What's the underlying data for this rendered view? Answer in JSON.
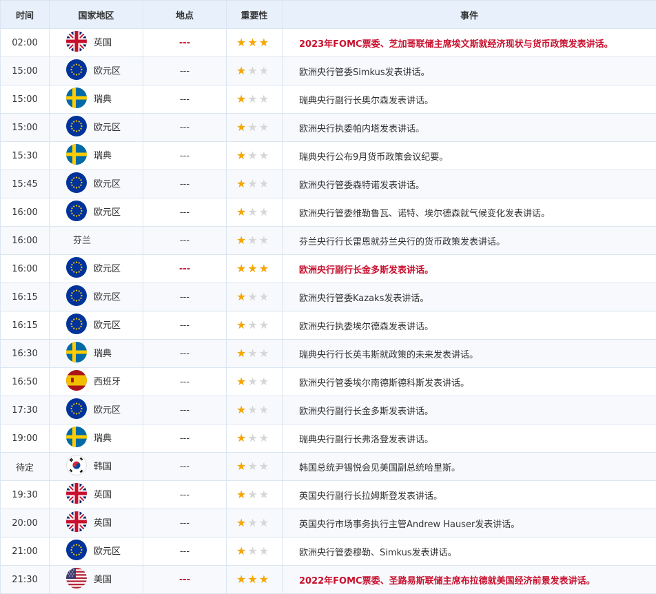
{
  "columns": {
    "time": "时间",
    "country": "国家地区",
    "location": "地点",
    "importance": "重要性",
    "event": "事件"
  },
  "colors": {
    "highlight": "#c8102e",
    "star_on": "#f5a500",
    "star_off": "#d6d6d6",
    "header_bg": "#e7f0fb"
  },
  "rows": [
    {
      "time": "02:00",
      "flag": "uk",
      "country": "英国",
      "location": "---",
      "stars": 3,
      "event": "2023年FOMC票委、芝加哥联储主席埃文斯就经济现状与货币政策发表讲话。",
      "highlight": true
    },
    {
      "time": "15:00",
      "flag": "eu",
      "country": "欧元区",
      "location": "---",
      "stars": 1,
      "event": "欧洲央行管委Simkus发表讲话。",
      "highlight": false
    },
    {
      "time": "15:00",
      "flag": "se",
      "country": "瑞典",
      "location": "---",
      "stars": 1,
      "event": "瑞典央行副行长奥尔森发表讲话。",
      "highlight": false
    },
    {
      "time": "15:00",
      "flag": "eu",
      "country": "欧元区",
      "location": "---",
      "stars": 1,
      "event": "欧洲央行执委帕内塔发表讲话。",
      "highlight": false
    },
    {
      "time": "15:30",
      "flag": "se",
      "country": "瑞典",
      "location": "---",
      "stars": 1,
      "event": "瑞典央行公布9月货币政策会议纪要。",
      "highlight": false
    },
    {
      "time": "15:45",
      "flag": "eu",
      "country": "欧元区",
      "location": "---",
      "stars": 1,
      "event": "欧洲央行管委森特诺发表讲话。",
      "highlight": false
    },
    {
      "time": "16:00",
      "flag": "eu",
      "country": "欧元区",
      "location": "---",
      "stars": 1,
      "event": "欧洲央行管委维勒鲁瓦、诺特、埃尔德森就气候变化发表讲话。",
      "highlight": false
    },
    {
      "time": "16:00",
      "flag": "none",
      "country": "芬兰",
      "location": "---",
      "stars": 1,
      "event": "芬兰央行行长雷恩就芬兰央行的货币政策发表讲话。",
      "highlight": false
    },
    {
      "time": "16:00",
      "flag": "eu",
      "country": "欧元区",
      "location": "---",
      "stars": 3,
      "event": "欧洲央行副行长金多斯发表讲话。",
      "highlight": true
    },
    {
      "time": "16:15",
      "flag": "eu",
      "country": "欧元区",
      "location": "---",
      "stars": 1,
      "event": "欧洲央行管委Kazaks发表讲话。",
      "highlight": false
    },
    {
      "time": "16:15",
      "flag": "eu",
      "country": "欧元区",
      "location": "---",
      "stars": 1,
      "event": "欧洲央行执委埃尔德森发表讲话。",
      "highlight": false
    },
    {
      "time": "16:30",
      "flag": "se",
      "country": "瑞典",
      "location": "---",
      "stars": 1,
      "event": "瑞典央行行长英韦斯就政策的未来发表讲话。",
      "highlight": false
    },
    {
      "time": "16:50",
      "flag": "es",
      "country": "西班牙",
      "location": "---",
      "stars": 1,
      "event": "欧洲央行管委埃尔南德斯德科斯发表讲话。",
      "highlight": false
    },
    {
      "time": "17:30",
      "flag": "eu",
      "country": "欧元区",
      "location": "---",
      "stars": 1,
      "event": "欧洲央行副行长金多斯发表讲话。",
      "highlight": false
    },
    {
      "time": "19:00",
      "flag": "se",
      "country": "瑞典",
      "location": "---",
      "stars": 1,
      "event": "瑞典央行副行长弗洛登发表讲话。",
      "highlight": false
    },
    {
      "time": "待定",
      "flag": "kr",
      "country": "韩国",
      "location": "---",
      "stars": 1,
      "event": "韩国总统尹锡悦会见美国副总统哈里斯。",
      "highlight": false
    },
    {
      "time": "19:30",
      "flag": "uk",
      "country": "英国",
      "location": "---",
      "stars": 1,
      "event": "英国央行副行长拉姆斯登发表讲话。",
      "highlight": false
    },
    {
      "time": "20:00",
      "flag": "uk",
      "country": "英国",
      "location": "---",
      "stars": 1,
      "event": "英国央行市场事务执行主管Andrew Hauser发表讲话。",
      "highlight": false
    },
    {
      "time": "21:00",
      "flag": "eu",
      "country": "欧元区",
      "location": "---",
      "stars": 1,
      "event": "欧洲央行管委穆勒、Simkus发表讲话。",
      "highlight": false
    },
    {
      "time": "21:30",
      "flag": "us",
      "country": "美国",
      "location": "---",
      "stars": 3,
      "event": "2022年FOMC票委、圣路易斯联储主席布拉德就美国经济前景发表讲话。",
      "highlight": true
    }
  ]
}
